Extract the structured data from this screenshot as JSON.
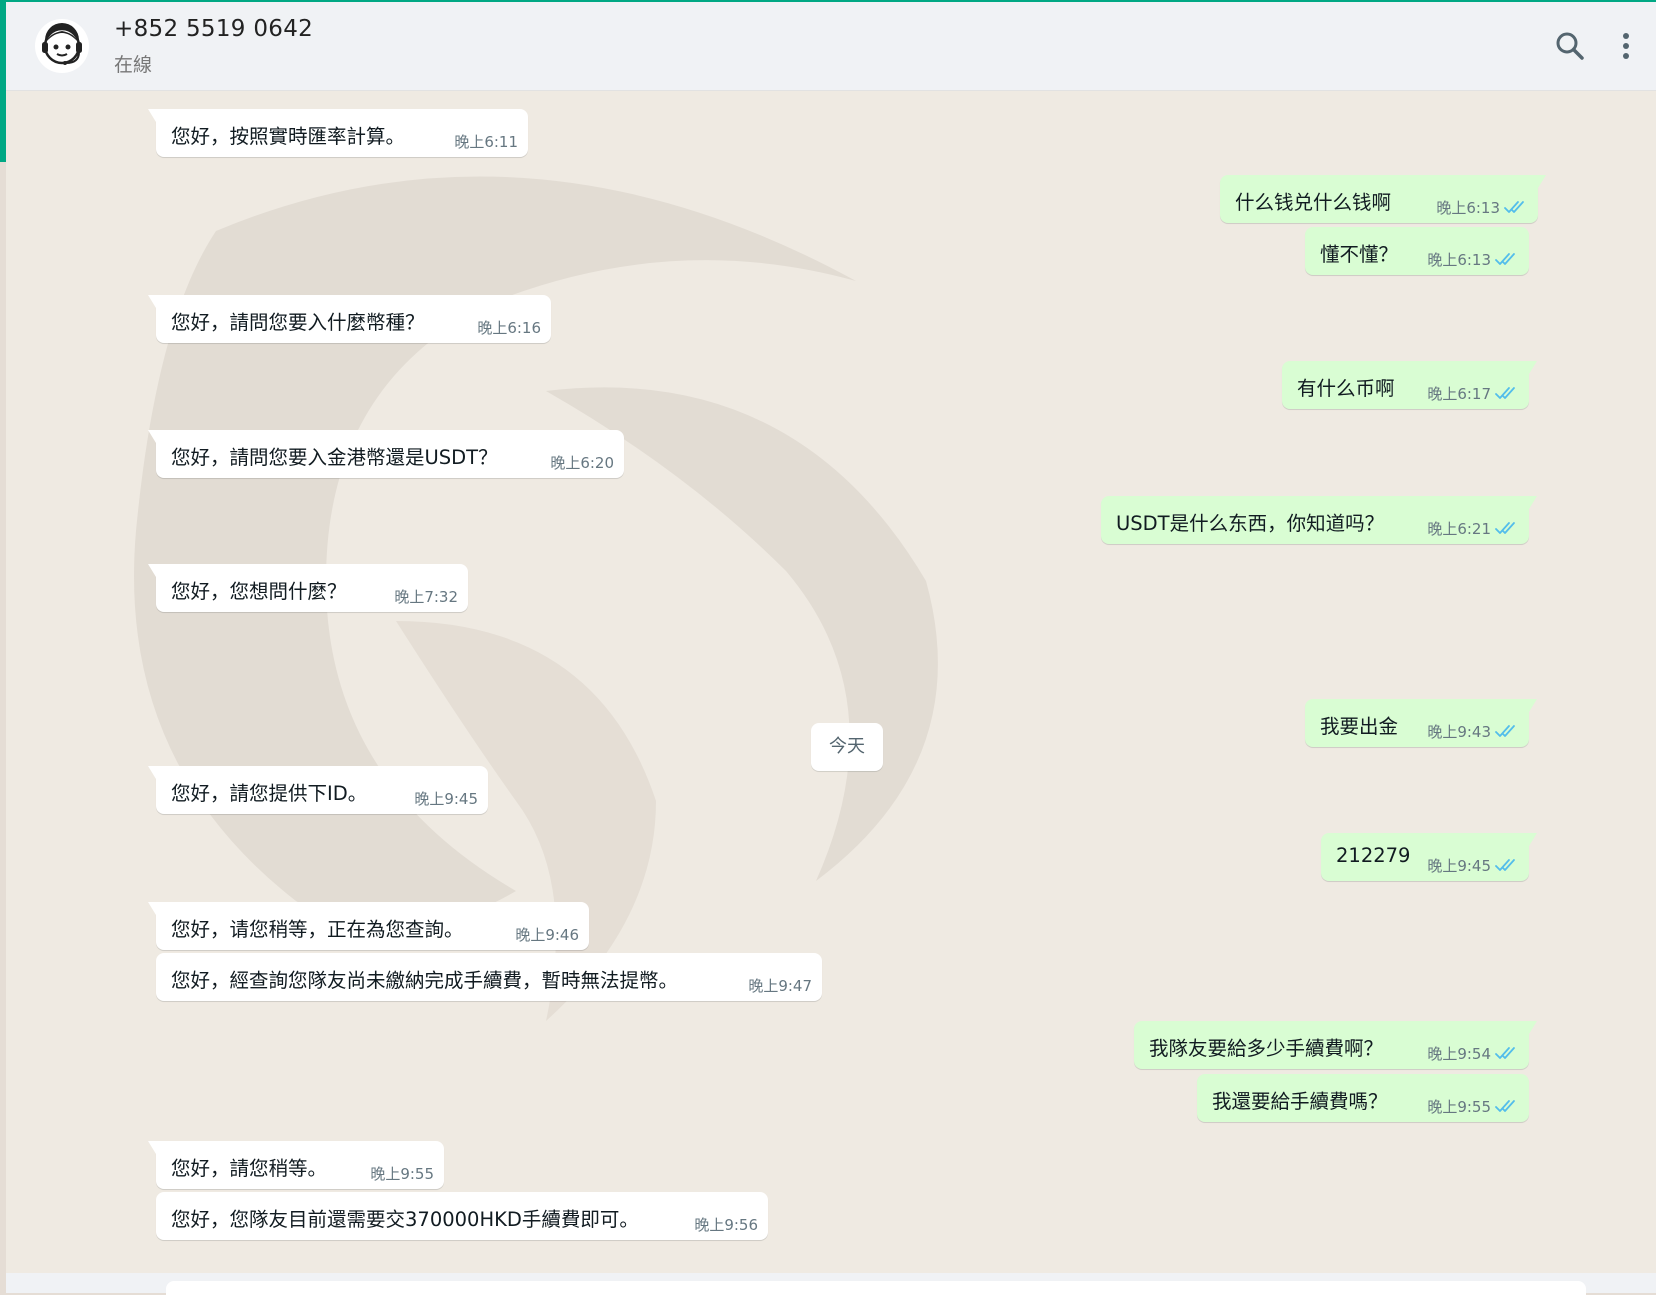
{
  "header": {
    "contact_name": "+852 5519 0642",
    "status": "在線",
    "search_icon": "search-icon",
    "menu_icon": "more-vertical-icon"
  },
  "colors": {
    "accent": "#00a884",
    "outgoing_bubble": "#d9fdd3",
    "incoming_bubble": "#ffffff",
    "chat_background": "#efeae2",
    "read_ticks": "#53bdeb"
  },
  "date_divider": "今天",
  "messages": [
    {
      "dir": "in",
      "text": "您好，按照實時匯率計算。",
      "time": "晚上6:11"
    },
    {
      "dir": "out",
      "text": "什么钱兑什么钱啊",
      "time": "晚上6:13",
      "status": "read"
    },
    {
      "dir": "out",
      "text": "懂不懂？",
      "time": "晚上6:13",
      "status": "read"
    },
    {
      "dir": "in",
      "text": "您好，請問您要入什麼幣種？",
      "time": "晚上6:16"
    },
    {
      "dir": "out",
      "text": "有什么币啊",
      "time": "晚上6:17",
      "status": "read"
    },
    {
      "dir": "in",
      "text": "您好，請問您要入金港幣還是USDT？",
      "time": "晚上6:20"
    },
    {
      "dir": "out",
      "text": "USDT是什么东西，你知道吗？",
      "time": "晚上6:21",
      "status": "read"
    },
    {
      "dir": "in",
      "text": "您好，您想問什麼？",
      "time": "晚上7:32"
    },
    {
      "dir": "out",
      "text": "我要出金",
      "time": "晚上9:43",
      "status": "read"
    },
    {
      "dir": "in",
      "text": "您好，請您提供下ID。",
      "time": "晚上9:45"
    },
    {
      "dir": "out",
      "text": "212279",
      "time": "晚上9:45",
      "status": "read"
    },
    {
      "dir": "in",
      "text": "您好，请您稍等，正在為您查詢。",
      "time": "晚上9:46"
    },
    {
      "dir": "in",
      "text": "您好，經查詢您隊友尚未繳納完成手續費，暫時無法提幣。",
      "time": "晚上9:47"
    },
    {
      "dir": "out",
      "text": "我隊友要給多少手續費啊？",
      "time": "晚上9:54",
      "status": "read"
    },
    {
      "dir": "out",
      "text": "我還要給手續費嗎？",
      "time": "晚上9:55",
      "status": "read"
    },
    {
      "dir": "in",
      "text": "您好，請您稍等。",
      "time": "晚上9:55"
    },
    {
      "dir": "in",
      "text": "您好，您隊友目前還需要交370000HKD手續費即可。",
      "time": "晚上9:56"
    }
  ]
}
